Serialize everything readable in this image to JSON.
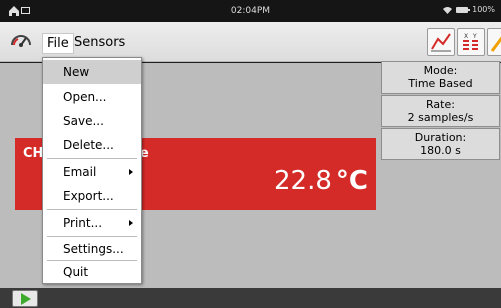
{
  "status_bar": {
    "time": "02:04PM",
    "battery": "100%",
    "icons": [
      "home-icon",
      "screen-icon",
      "wifi-icon",
      "battery-icon"
    ]
  },
  "menubar": {
    "file": "File",
    "sensors": "Sensors",
    "icons": [
      "gauge-icon",
      "graph-icon",
      "table-icon",
      "annotate-icon"
    ]
  },
  "dropdown": {
    "items": [
      {
        "label": "New"
      },
      {
        "label": "Open..."
      },
      {
        "label": "Save..."
      },
      {
        "label": "Delete..."
      },
      {
        "label": "Email"
      },
      {
        "label": "Export..."
      },
      {
        "label": "Print..."
      },
      {
        "label": "Settings..."
      },
      {
        "label": "Quit"
      }
    ]
  },
  "reading": {
    "channel_left": "CH",
    "channel_right": "ture",
    "value": "22.8",
    "unit": "°C",
    "color": "#d42a28"
  },
  "info": {
    "mode_label": "Mode:",
    "mode_value": "Time Based",
    "rate_label": "Rate:",
    "rate_value": "2 samples/s",
    "duration_label": "Duration:",
    "duration_value": "180.0 s"
  },
  "bottom": {
    "play_icon": "play-icon",
    "accent": "#3caa2a"
  }
}
